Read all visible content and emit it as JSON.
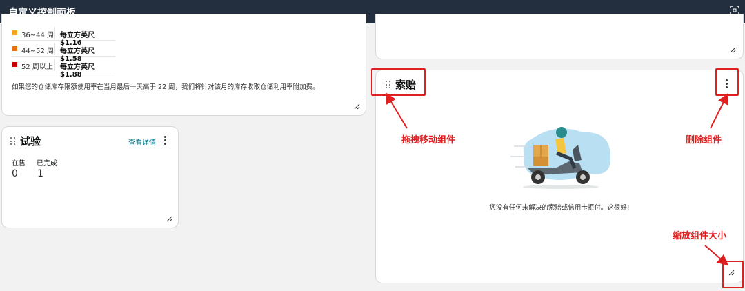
{
  "window": {
    "title": "自定义控制面板"
  },
  "storage_card": {
    "rates": [
      {
        "label": "36~44 周",
        "value": "每立方英尺 $1.16",
        "color": "#f7a21b"
      },
      {
        "label": "44~52 周",
        "value": "每立方英尺 $1.58",
        "color": "#e8700b"
      },
      {
        "label": "52 周以上",
        "value": "每立方英尺 $1.88",
        "color": "#c40000"
      }
    ],
    "note": "如果您的仓储库存限额使用率在当月最后一天高于 22 周，我们将针对该月的库存收取仓储利用率附加费。"
  },
  "trial_card": {
    "title": "试验",
    "details_link": "查看详情",
    "stats": [
      {
        "label": "在售",
        "value": "0"
      },
      {
        "label": "已完成",
        "value": "1"
      }
    ]
  },
  "claims_card": {
    "title": "索赔",
    "empty_message": "您没有任何未解决的索赔或信用卡拒付。这很好!"
  },
  "annotations": {
    "drag": "拖拽移动组件",
    "delete": "删除组件",
    "resize": "缩放组件大小"
  },
  "colors": {
    "header_bg": "#232f3e",
    "link": "#007185",
    "annotation": "#e02020"
  }
}
